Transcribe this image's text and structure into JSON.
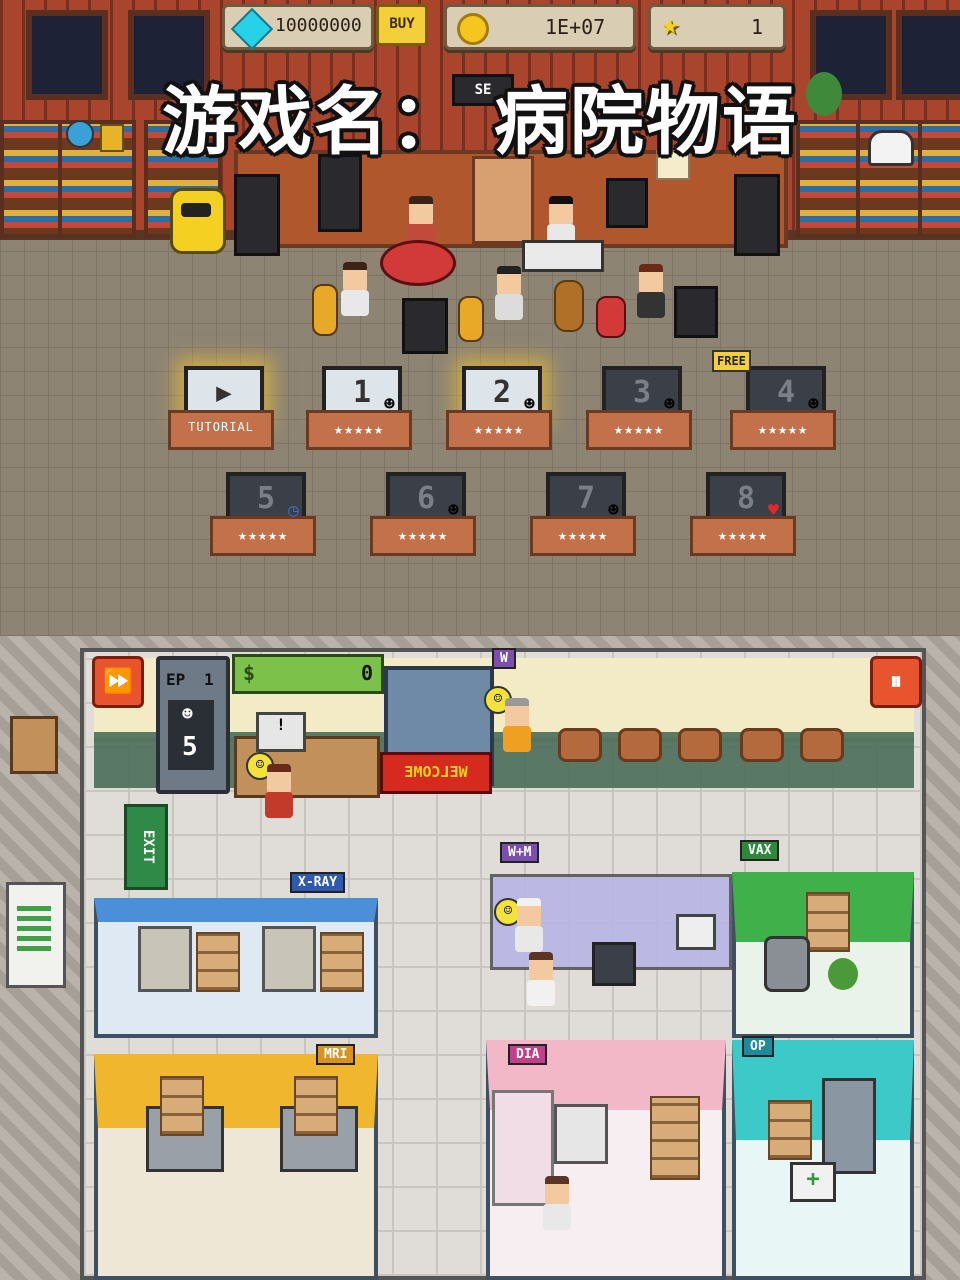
{
  "hud": {
    "gems": "10000000",
    "buy_label": "BUY",
    "coins": "1E+07",
    "stars": "1"
  },
  "overlay_title": "游戏名： 病院物语",
  "stage_sign": "SE",
  "levels": [
    {
      "label": "",
      "caption": "TUTORIAL",
      "stars": "",
      "icon": "play-icon",
      "active": true
    },
    {
      "label": "1",
      "caption": "",
      "stars": "★★★★★",
      "icon": "face-icon",
      "active": false
    },
    {
      "label": "2",
      "caption": "",
      "stars": "★★★★★",
      "icon": "face-icon",
      "active": true
    },
    {
      "label": "3",
      "caption": "",
      "stars": "★★★★★",
      "icon": "face-icon",
      "active": false
    },
    {
      "label": "4",
      "caption": "",
      "stars": "★★★★★",
      "icon": "face-icon",
      "active": false
    },
    {
      "label": "5",
      "caption": "",
      "stars": "★★★★★",
      "icon": "clock-icon",
      "active": false
    },
    {
      "label": "6",
      "caption": "",
      "stars": "★★★★★",
      "icon": "face-icon",
      "active": false
    },
    {
      "label": "7",
      "caption": "",
      "stars": "★★★★★",
      "icon": "face-icon",
      "active": false
    },
    {
      "label": "8",
      "caption": "",
      "stars": "★★★★★",
      "icon": "heart-icon",
      "active": false
    }
  ],
  "free_badge": "FREE",
  "hospital": {
    "money_symbol": "$",
    "money": "0",
    "episode_label": "EP",
    "episode_num": "1",
    "patients_left": "5",
    "welcome_sign": "WELCOME",
    "exit_sign": "EXIT",
    "rooms": {
      "waiting": "W",
      "wm": "W+M",
      "vax": "VAX",
      "xray": "X-RAY",
      "mri": "MRI",
      "dia": "DIA",
      "op": "OP"
    },
    "fast_forward_icon": "fast-forward-icon",
    "pause_icon": "pause-icon"
  },
  "colors": {
    "wall_red": "#a8452c",
    "hud_tan": "#d9ceb4",
    "button_orange": "#e8542e",
    "xray_blue": "#4a8fd8",
    "mri_yellow": "#f0b62e",
    "dia_pink": "#f3b8c8",
    "op_teal": "#3ec9c9",
    "vax_green": "#3fb04a",
    "room_tag_purple": "#7a4fb0"
  }
}
